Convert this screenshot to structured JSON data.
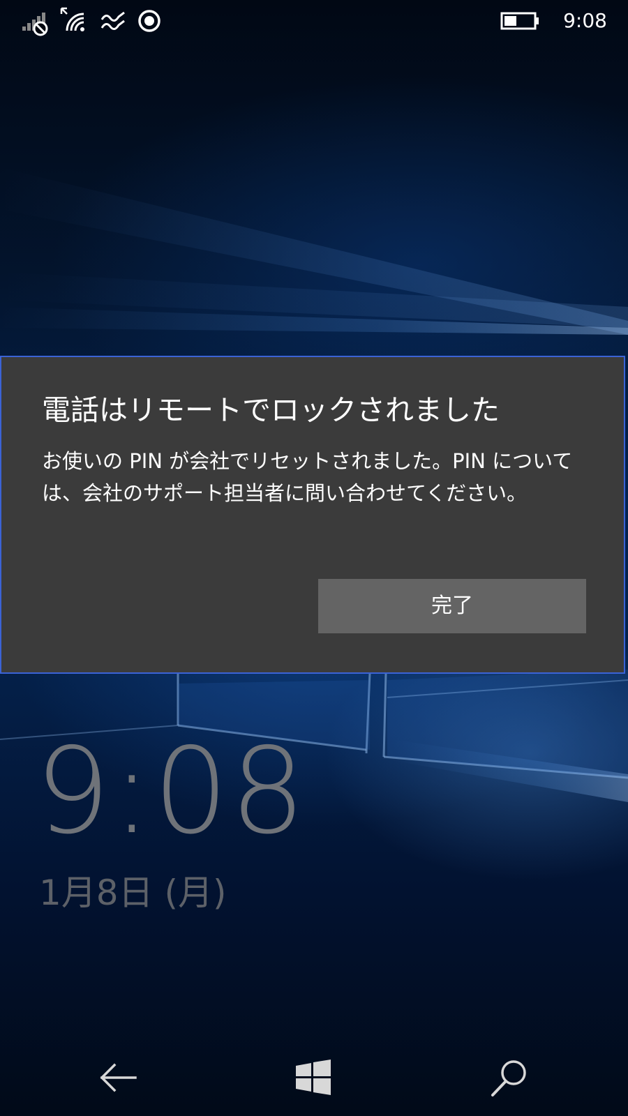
{
  "status_bar": {
    "time": "9:08",
    "icons": [
      "signal-no-sim-icon",
      "wifi-icon",
      "vibrate-icon",
      "location-icon",
      "battery-icon"
    ]
  },
  "dialog": {
    "title": "電話はリモートでロックされました",
    "body": "お使いの PIN が会社でリセットされました。PIN については、会社のサポート担当者に問い合わせてください。",
    "button_label": "完了"
  },
  "lock_screen": {
    "time": "9:08",
    "date": "1月8日 (月)"
  },
  "nav_bar": {
    "icons": [
      "back-arrow-icon",
      "windows-start-icon",
      "search-icon"
    ]
  },
  "colors": {
    "dialog_background": "#3b3b3b",
    "dialog_border": "#3b63d6",
    "button_background": "#646464",
    "lock_text": "#6f7379"
  }
}
